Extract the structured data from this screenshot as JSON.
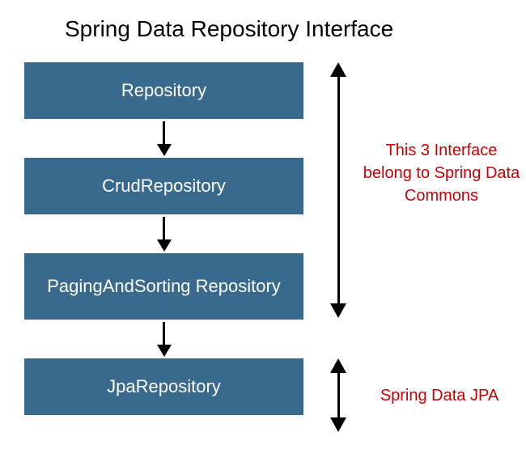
{
  "title": "Spring Data Repository Interface",
  "boxes": {
    "b0": "Repository",
    "b1": "CrudRepository",
    "b2": "PagingAndSorting Repository",
    "b3": "JpaRepository"
  },
  "annotations": {
    "commons": "This 3 Interface belong to Spring Data Commons",
    "jpa": "Spring Data JPA"
  },
  "colors": {
    "box_bg": "#39698c",
    "annotation": "#cc0000"
  }
}
